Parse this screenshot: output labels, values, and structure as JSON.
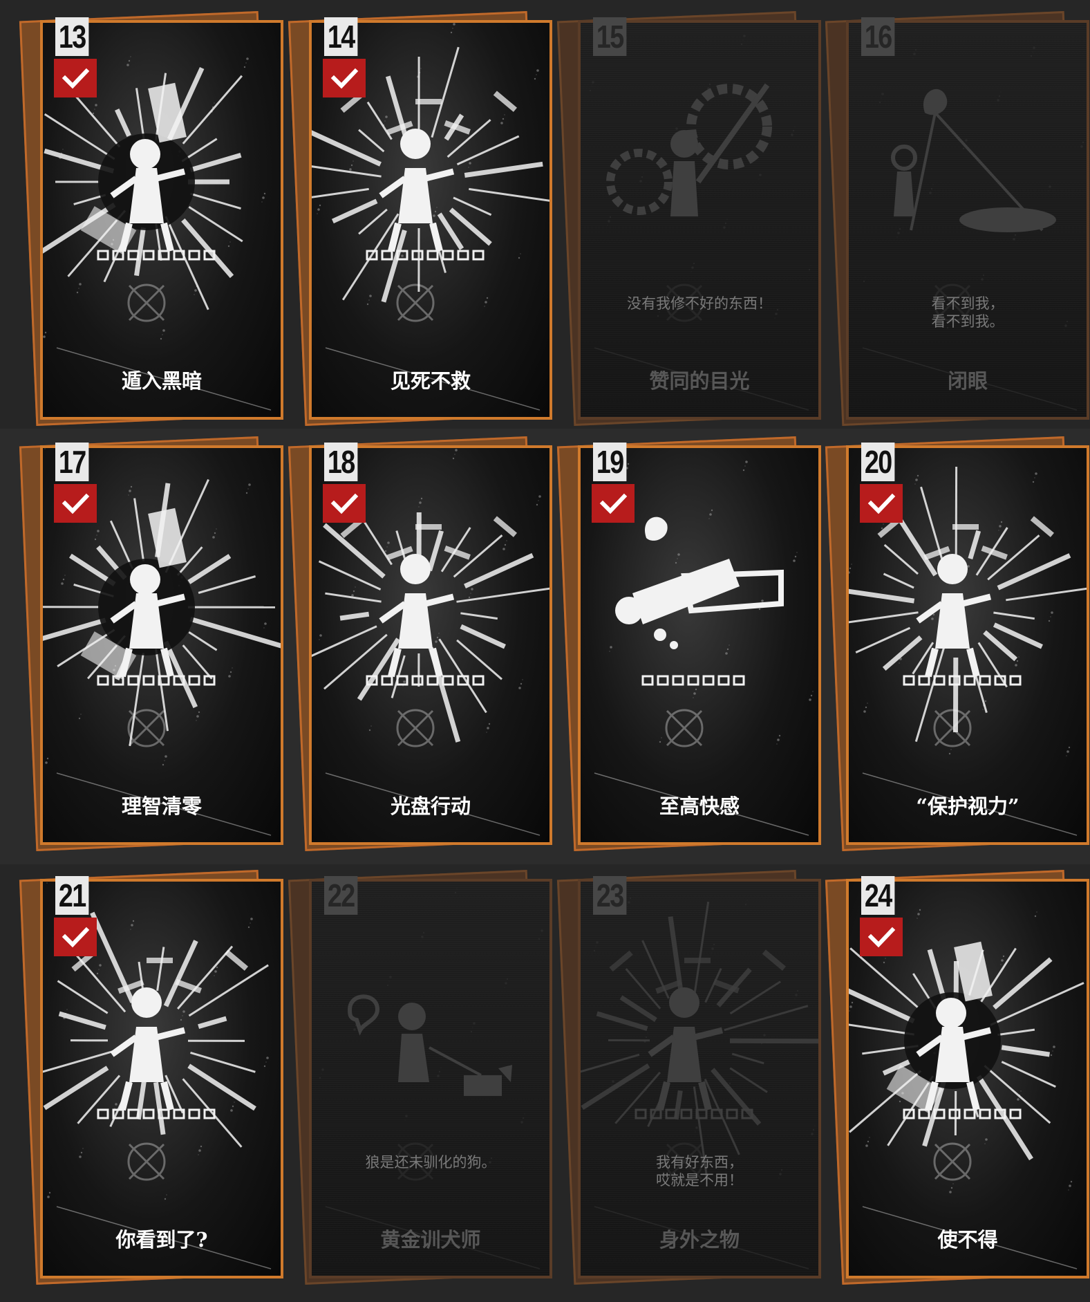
{
  "cards": [
    {
      "number": "13",
      "title": "遁入黑暗",
      "unlocked": true,
      "motif": "burst"
    },
    {
      "number": "14",
      "title": "见死不救",
      "unlocked": true,
      "motif": "scream"
    },
    {
      "number": "15",
      "title": "赞同的目光",
      "unlocked": false,
      "motif": "gears",
      "quote": "没有我修不好的东西！"
    },
    {
      "number": "16",
      "title": "闭眼",
      "unlocked": false,
      "motif": "lamp",
      "quote": "看不到我，\n看不到我。"
    },
    {
      "number": "17",
      "title": "理智清零",
      "unlocked": true,
      "motif": "burst"
    },
    {
      "number": "18",
      "title": "光盘行动",
      "unlocked": true,
      "motif": "scream"
    },
    {
      "number": "19",
      "title": "至高快感",
      "unlocked": true,
      "motif": "lying"
    },
    {
      "number": "20",
      "title": "“保护视力”",
      "unlocked": true,
      "motif": "scream"
    },
    {
      "number": "21",
      "title": "你看到了?",
      "unlocked": true,
      "motif": "scream"
    },
    {
      "number": "22",
      "title": "黄金训犬师",
      "unlocked": false,
      "motif": "dog",
      "quote": "狼是还未驯化的狗。"
    },
    {
      "number": "23",
      "title": "身外之物",
      "unlocked": false,
      "motif": "scream",
      "quote": "我有好东西，\n哎就是不用！"
    },
    {
      "number": "24",
      "title": "使不得",
      "unlocked": true,
      "motif": "burst"
    }
  ],
  "colors": {
    "card_border_unlocked": "#d07a2c",
    "card_border_locked": "#5a3c27",
    "check_badge": "#b71c1c",
    "title_unlocked": "#ffffff",
    "title_locked": "#575757"
  },
  "icons": {
    "achievement_check": "check-icon",
    "card_emblem": "emblem-icon"
  }
}
